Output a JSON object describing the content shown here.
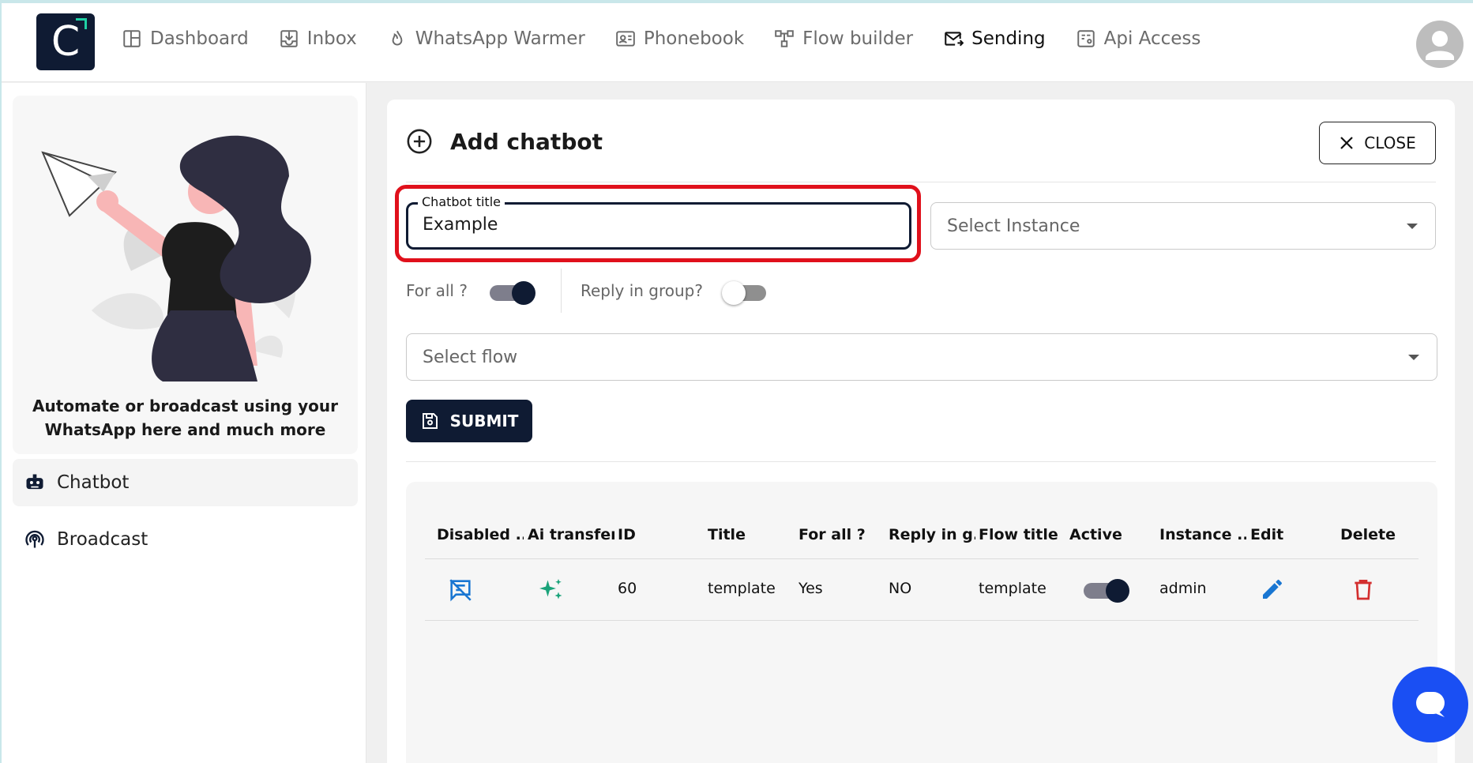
{
  "logo": {
    "letter": "C"
  },
  "nav": {
    "items": [
      {
        "label": "Dashboard",
        "icon": "dashboard-icon"
      },
      {
        "label": "Inbox",
        "icon": "inbox-icon"
      },
      {
        "label": "WhatsApp Warmer",
        "icon": "flame-icon"
      },
      {
        "label": "Phonebook",
        "icon": "contact-card-icon"
      },
      {
        "label": "Flow builder",
        "icon": "flow-icon"
      },
      {
        "label": "Sending",
        "icon": "mail-send-icon",
        "active": true
      },
      {
        "label": "Api Access",
        "icon": "api-icon"
      }
    ]
  },
  "sidebar": {
    "promo_text_line1": "Automate or broadcast using your",
    "promo_text_line2": "WhatsApp here and much more",
    "items": [
      {
        "label": "Chatbot",
        "icon": "robot-icon",
        "active": true
      },
      {
        "label": "Broadcast",
        "icon": "broadcast-icon"
      }
    ]
  },
  "panel": {
    "title": "Add chatbot",
    "close_label": "CLOSE",
    "chatbot_title_label": "Chatbot title",
    "chatbot_title_value": "Example",
    "instance_placeholder": "Select Instance",
    "for_all_label": "For all ?",
    "for_all_on": true,
    "reply_group_label": "Reply in group?",
    "reply_group_on": false,
    "flow_placeholder": "Select flow",
    "submit_label": "SUBMIT"
  },
  "table": {
    "headers": [
      "Disabled ...",
      "Ai transfer",
      "ID",
      "Title",
      "For all ?",
      "Reply in g...",
      "Flow title",
      "Active",
      "Instance ...",
      "Edit",
      "Delete"
    ],
    "rows": [
      {
        "id": "60",
        "title": "template",
        "for_all": "Yes",
        "reply_group": "NO",
        "flow_title": "template",
        "active": true,
        "instance": "admin"
      }
    ]
  },
  "colors": {
    "primary": "#0f1b33",
    "accent": "#1fd1a5",
    "highlight": "#e0101b",
    "fab": "#1a4ff3",
    "edit": "#1976d2",
    "delete": "#d32f2f",
    "ai": "#1aa37a"
  }
}
